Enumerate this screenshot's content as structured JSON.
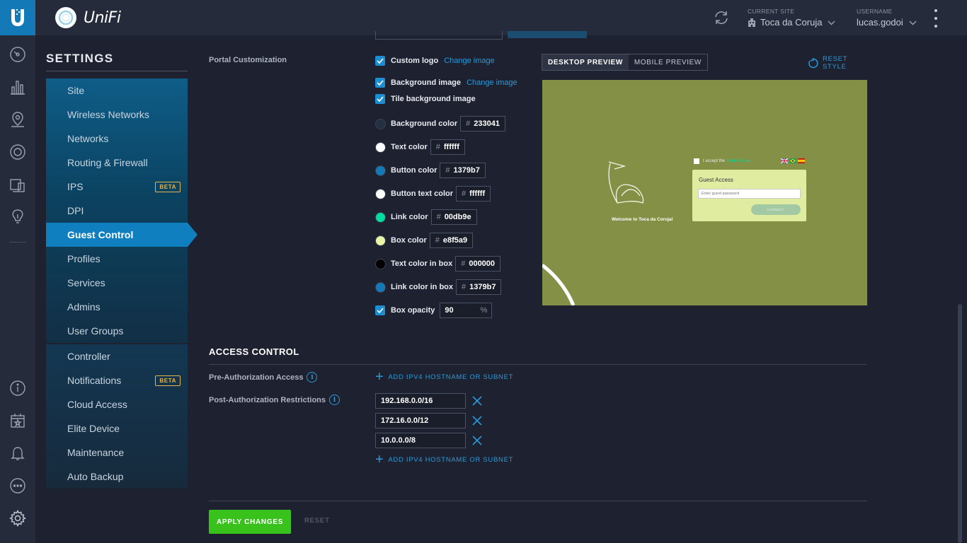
{
  "app": {
    "name": "UniFi"
  },
  "topbar": {
    "site_label": "CURRENT SITE",
    "site_value": "Toca da Coruja",
    "user_label": "USERNAME",
    "user_value": "lucas.godoi"
  },
  "rail": {
    "icons": [
      "dashboard-icon",
      "statistics-icon",
      "map-icon",
      "devices-icon",
      "clients-icon",
      "insights-icon",
      "info-icon",
      "events-icon",
      "alerts-icon",
      "chat-icon",
      "settings-icon"
    ]
  },
  "settings": {
    "title": "SETTINGS",
    "nav": [
      {
        "label": "Site"
      },
      {
        "label": "Wireless Networks"
      },
      {
        "label": "Networks"
      },
      {
        "label": "Routing & Firewall"
      },
      {
        "label": "IPS",
        "badge": "BETA"
      },
      {
        "label": "DPI"
      },
      {
        "label": "Guest Control",
        "active": true
      },
      {
        "label": "Profiles"
      },
      {
        "label": "Services"
      },
      {
        "label": "Admins"
      },
      {
        "label": "User Groups"
      }
    ],
    "nav2": [
      {
        "label": "Controller"
      },
      {
        "label": "Notifications",
        "badge": "BETA"
      },
      {
        "label": "Cloud Access"
      },
      {
        "label": "Elite Device"
      },
      {
        "label": "Maintenance"
      },
      {
        "label": "Auto Backup"
      }
    ]
  },
  "portal": {
    "label": "Portal Customization",
    "custom_logo": "Custom logo",
    "background_image": "Background image",
    "tile_background": "Tile background image",
    "change_image": "Change image",
    "colors": [
      {
        "label": "Background color",
        "hex": "233041",
        "swatch": "#233041"
      },
      {
        "label": "Text color",
        "hex": "ffffff",
        "swatch": "#ffffff"
      },
      {
        "label": "Button color",
        "hex": "1379b7",
        "swatch": "#1379b7"
      },
      {
        "label": "Button text color",
        "hex": "ffffff",
        "swatch": "#ffffff"
      },
      {
        "label": "Link color",
        "hex": "00db9e",
        "swatch": "#00db9e"
      },
      {
        "label": "Box color",
        "hex": "e8f5a9",
        "swatch": "#e8f5a9"
      },
      {
        "label": "Text color in box",
        "hex": "000000",
        "swatch": "#000000"
      },
      {
        "label": "Link color in box",
        "hex": "1379b7",
        "swatch": "#1379b7"
      }
    ],
    "box_opacity_label": "Box opacity",
    "box_opacity_value": "90",
    "percent": "%",
    "hash": "#"
  },
  "preview": {
    "desktop_tab": "DESKTOP PREVIEW",
    "mobile_tab": "MOBILE PREVIEW",
    "reset_style": "RESET STYLE",
    "welcome": "Welcome to Toca da Coruja!",
    "accept_text": "I accept the",
    "accept_link": "terms of use",
    "box_title": "Guest Access",
    "password_placeholder": "Enter guest password",
    "connect": "CONNECT",
    "background": "#849045"
  },
  "access": {
    "title": "ACCESS CONTROL",
    "pre_auth_label": "Pre-Authorization Access",
    "post_auth_label": "Post-Authorization Restrictions",
    "add_label": "ADD IPV4 HOSTNAME OR SUBNET",
    "subnets": [
      "192.168.0.0/16",
      "172.16.0.0/12",
      "10.0.0.0/8"
    ]
  },
  "footer": {
    "apply": "APPLY CHANGES",
    "reset": "RESET"
  }
}
